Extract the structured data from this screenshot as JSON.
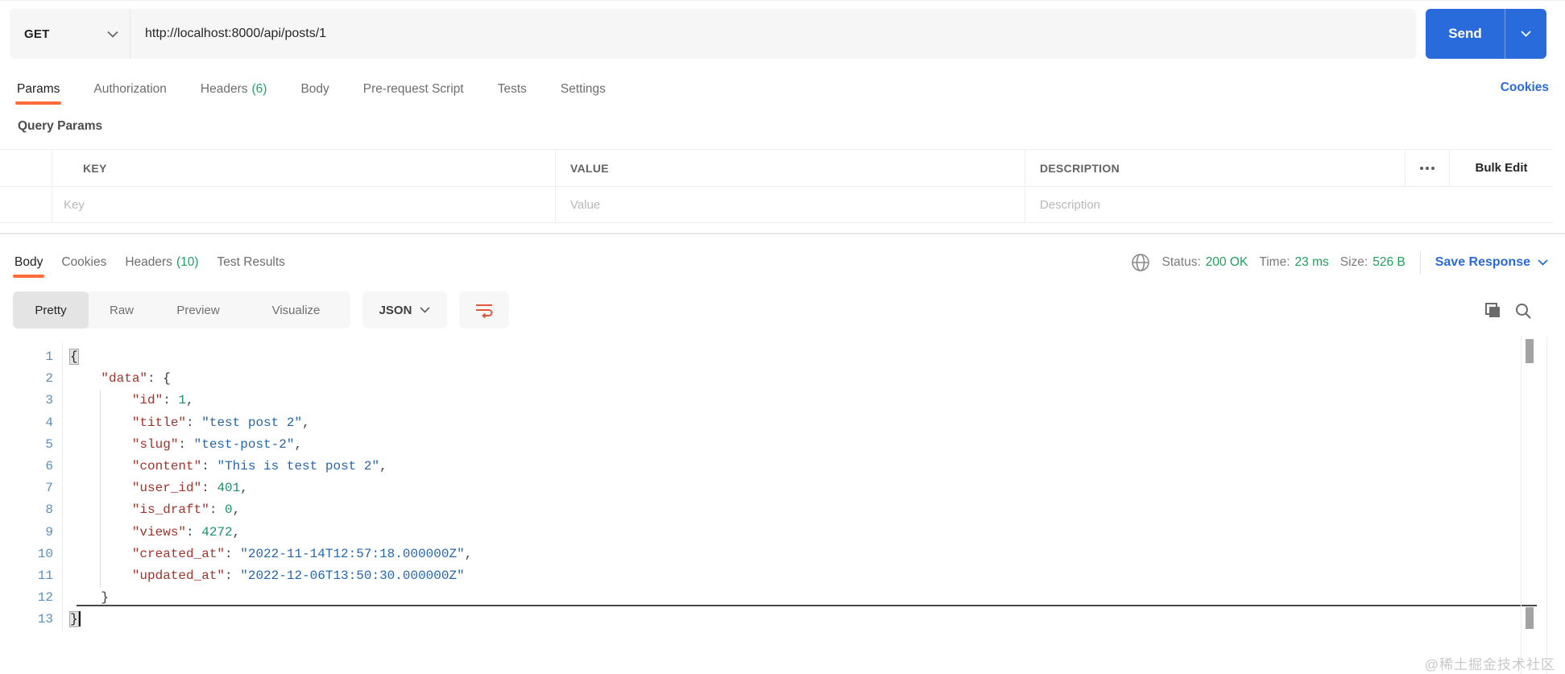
{
  "request": {
    "method": "GET",
    "url": "http://localhost:8000/api/posts/1",
    "send_label": "Send",
    "cookies_link": "Cookies",
    "tabs": [
      {
        "label": "Params"
      },
      {
        "label": "Authorization"
      },
      {
        "label": "Headers",
        "count": "(6)"
      },
      {
        "label": "Body"
      },
      {
        "label": "Pre-request Script"
      },
      {
        "label": "Tests"
      },
      {
        "label": "Settings"
      }
    ]
  },
  "query_params": {
    "title": "Query Params",
    "columns": {
      "key": "KEY",
      "value": "VALUE",
      "description": "DESCRIPTION"
    },
    "bulk_edit_label": "Bulk Edit",
    "placeholders": {
      "key": "Key",
      "value": "Value",
      "description": "Description"
    }
  },
  "response": {
    "tabs": [
      {
        "label": "Body"
      },
      {
        "label": "Cookies"
      },
      {
        "label": "Headers",
        "count": "(10)"
      },
      {
        "label": "Test Results"
      }
    ],
    "meta": {
      "status_label": "Status:",
      "status_value": "200 OK",
      "time_label": "Time:",
      "time_value": "23 ms",
      "size_label": "Size:",
      "size_value": "526 B",
      "save_label": "Save Response"
    },
    "view_tabs": {
      "pretty": "Pretty",
      "raw": "Raw",
      "preview": "Preview",
      "visualize": "Visualize"
    },
    "language": "JSON"
  },
  "code": {
    "lines": [
      {
        "n": 1,
        "tokens": [
          [
            "hlbrace",
            "{"
          ]
        ]
      },
      {
        "n": 2,
        "tokens": [
          [
            "ws",
            "    "
          ],
          [
            "key",
            "\"data\""
          ],
          [
            "punc",
            ": "
          ],
          [
            "brace",
            "{"
          ]
        ]
      },
      {
        "n": 3,
        "tokens": [
          [
            "ws",
            "        "
          ],
          [
            "key",
            "\"id\""
          ],
          [
            "punc",
            ": "
          ],
          [
            "num",
            "1"
          ],
          [
            "punc",
            ","
          ]
        ]
      },
      {
        "n": 4,
        "tokens": [
          [
            "ws",
            "        "
          ],
          [
            "key",
            "\"title\""
          ],
          [
            "punc",
            ": "
          ],
          [
            "str",
            "\"test post 2\""
          ],
          [
            "punc",
            ","
          ]
        ]
      },
      {
        "n": 5,
        "tokens": [
          [
            "ws",
            "        "
          ],
          [
            "key",
            "\"slug\""
          ],
          [
            "punc",
            ": "
          ],
          [
            "str",
            "\"test-post-2\""
          ],
          [
            "punc",
            ","
          ]
        ]
      },
      {
        "n": 6,
        "tokens": [
          [
            "ws",
            "        "
          ],
          [
            "key",
            "\"content\""
          ],
          [
            "punc",
            ": "
          ],
          [
            "str",
            "\"This is test post 2\""
          ],
          [
            "punc",
            ","
          ]
        ]
      },
      {
        "n": 7,
        "tokens": [
          [
            "ws",
            "        "
          ],
          [
            "key",
            "\"user_id\""
          ],
          [
            "punc",
            ": "
          ],
          [
            "num",
            "401"
          ],
          [
            "punc",
            ","
          ]
        ]
      },
      {
        "n": 8,
        "tokens": [
          [
            "ws",
            "        "
          ],
          [
            "key",
            "\"is_draft\""
          ],
          [
            "punc",
            ": "
          ],
          [
            "num",
            "0"
          ],
          [
            "punc",
            ","
          ]
        ]
      },
      {
        "n": 9,
        "tokens": [
          [
            "ws",
            "        "
          ],
          [
            "key",
            "\"views\""
          ],
          [
            "punc",
            ": "
          ],
          [
            "num",
            "4272"
          ],
          [
            "punc",
            ","
          ]
        ]
      },
      {
        "n": 10,
        "tokens": [
          [
            "ws",
            "        "
          ],
          [
            "key",
            "\"created_at\""
          ],
          [
            "punc",
            ": "
          ],
          [
            "str",
            "\"2022-11-14T12:57:18.000000Z\""
          ],
          [
            "punc",
            ","
          ]
        ]
      },
      {
        "n": 11,
        "tokens": [
          [
            "ws",
            "        "
          ],
          [
            "key",
            "\"updated_at\""
          ],
          [
            "punc",
            ": "
          ],
          [
            "str",
            "\"2022-12-06T13:50:30.000000Z\""
          ]
        ]
      },
      {
        "n": 12,
        "tokens": [
          [
            "ws",
            "    "
          ],
          [
            "brace",
            "}"
          ]
        ]
      },
      {
        "n": 13,
        "tokens": [
          [
            "hlbrace",
            "}"
          ],
          [
            "cursor",
            ""
          ]
        ]
      }
    ]
  },
  "watermark": "@稀土掘金技术社区",
  "colors": {
    "accent_orange": "#ff6c37",
    "count_green": "#23a164",
    "status_green": "#1fa05c",
    "link_blue": "#2b6bd6",
    "send_blue": "#2a6bdb",
    "json_key": "#a0342b",
    "json_string": "#2566ae",
    "json_number": "#1c8f6d",
    "line_number_blue": "#5b8fbe"
  }
}
